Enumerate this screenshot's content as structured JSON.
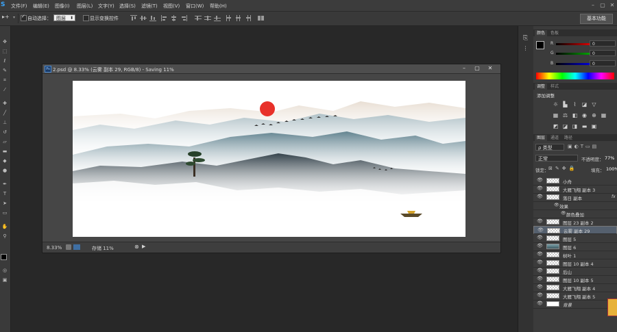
{
  "app": {
    "logo": "S"
  },
  "menu": [
    "文件(F)",
    "编辑(E)",
    "图像(I)",
    "图层(L)",
    "文字(Y)",
    "选择(S)",
    "滤镜(T)",
    "视图(V)",
    "窗口(W)",
    "帮助(H)"
  ],
  "options": {
    "auto_select_label": "自动选择：",
    "auto_select_value": "图层",
    "show_transform_label": "显示变换控件",
    "workspace": "基本功能"
  },
  "document": {
    "title": "2.psd @ 8.33% (云雾 副本 29, RGB/8) - Saving 11%",
    "zoom": "8.33%",
    "status": "存储 11%"
  },
  "color_panel": {
    "tabs": [
      "颜色",
      "色板"
    ],
    "channels": [
      {
        "label": "R",
        "value": "0",
        "color": "#ff0000"
      },
      {
        "label": "G",
        "value": "0",
        "color": "#00c000"
      },
      {
        "label": "B",
        "value": "0",
        "color": "#0000ff"
      }
    ]
  },
  "adjust_panel": {
    "tabs": [
      "调整",
      "样式"
    ],
    "heading": "添加调整"
  },
  "layers_panel": {
    "tabs": [
      "图层",
      "通道",
      "路径"
    ],
    "kind_filter": "ρ 类型",
    "blend_mode": "正常",
    "opacity_label": "不透明度：",
    "opacity_value": "77%",
    "lock_label": "锁定：",
    "fill_label": "填充：",
    "fill_value": "100%",
    "layers": [
      {
        "name": "小舟"
      },
      {
        "name": "大雁飞翔 副本 3"
      },
      {
        "name": "落日 副本",
        "fx": "fx"
      },
      {
        "name": "效果"
      },
      {
        "name": "颜色叠加"
      },
      {
        "name": "图层 23 副本 2"
      },
      {
        "name": "云雾 副本 29"
      },
      {
        "name": "图层 5"
      },
      {
        "name": "图层 6"
      },
      {
        "name": "树叶 1"
      },
      {
        "name": "图层 10 副本 4"
      },
      {
        "name": "后山"
      },
      {
        "name": "图层 10 副本 5"
      },
      {
        "name": "大雁飞翔 副本 4"
      },
      {
        "name": "大雁飞翔 副本 5"
      },
      {
        "name": "背景"
      }
    ]
  }
}
